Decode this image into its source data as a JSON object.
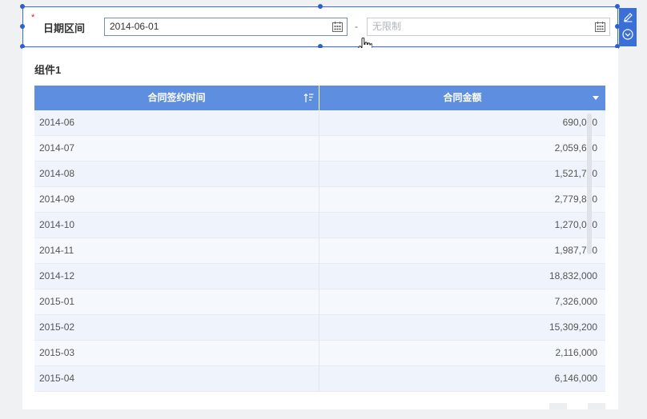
{
  "filter": {
    "required_mark": "*",
    "label": "日期区间",
    "start_value": "2014-06-01",
    "end_placeholder": "无限制",
    "separator": "-"
  },
  "toolbar": {
    "edit_icon": "pencil-icon",
    "collapse_icon": "chevron-down-circle-icon"
  },
  "panel": {
    "title": "组件1"
  },
  "table": {
    "columns": [
      {
        "label": "合同签约时间",
        "icon": "sort-icon"
      },
      {
        "label": "合同金额",
        "icon": "dropdown-icon"
      }
    ],
    "rows": [
      {
        "date": "2014-06",
        "amount": "690,000"
      },
      {
        "date": "2014-07",
        "amount": "2,059,600"
      },
      {
        "date": "2014-08",
        "amount": "1,521,700"
      },
      {
        "date": "2014-09",
        "amount": "2,779,800"
      },
      {
        "date": "2014-10",
        "amount": "1,270,000"
      },
      {
        "date": "2014-11",
        "amount": "1,987,700"
      },
      {
        "date": "2014-12",
        "amount": "18,832,000"
      },
      {
        "date": "2015-01",
        "amount": "7,326,000"
      },
      {
        "date": "2015-02",
        "amount": "15,309,200"
      },
      {
        "date": "2015-03",
        "amount": "2,116,000"
      },
      {
        "date": "2015-04",
        "amount": "6,146,000"
      }
    ]
  },
  "colors": {
    "accent": "#3a6fd8",
    "header_bg": "#5e8ee0",
    "row_odd": "#eff3fb",
    "row_even": "#f5f9fd",
    "required": "#e02020"
  }
}
